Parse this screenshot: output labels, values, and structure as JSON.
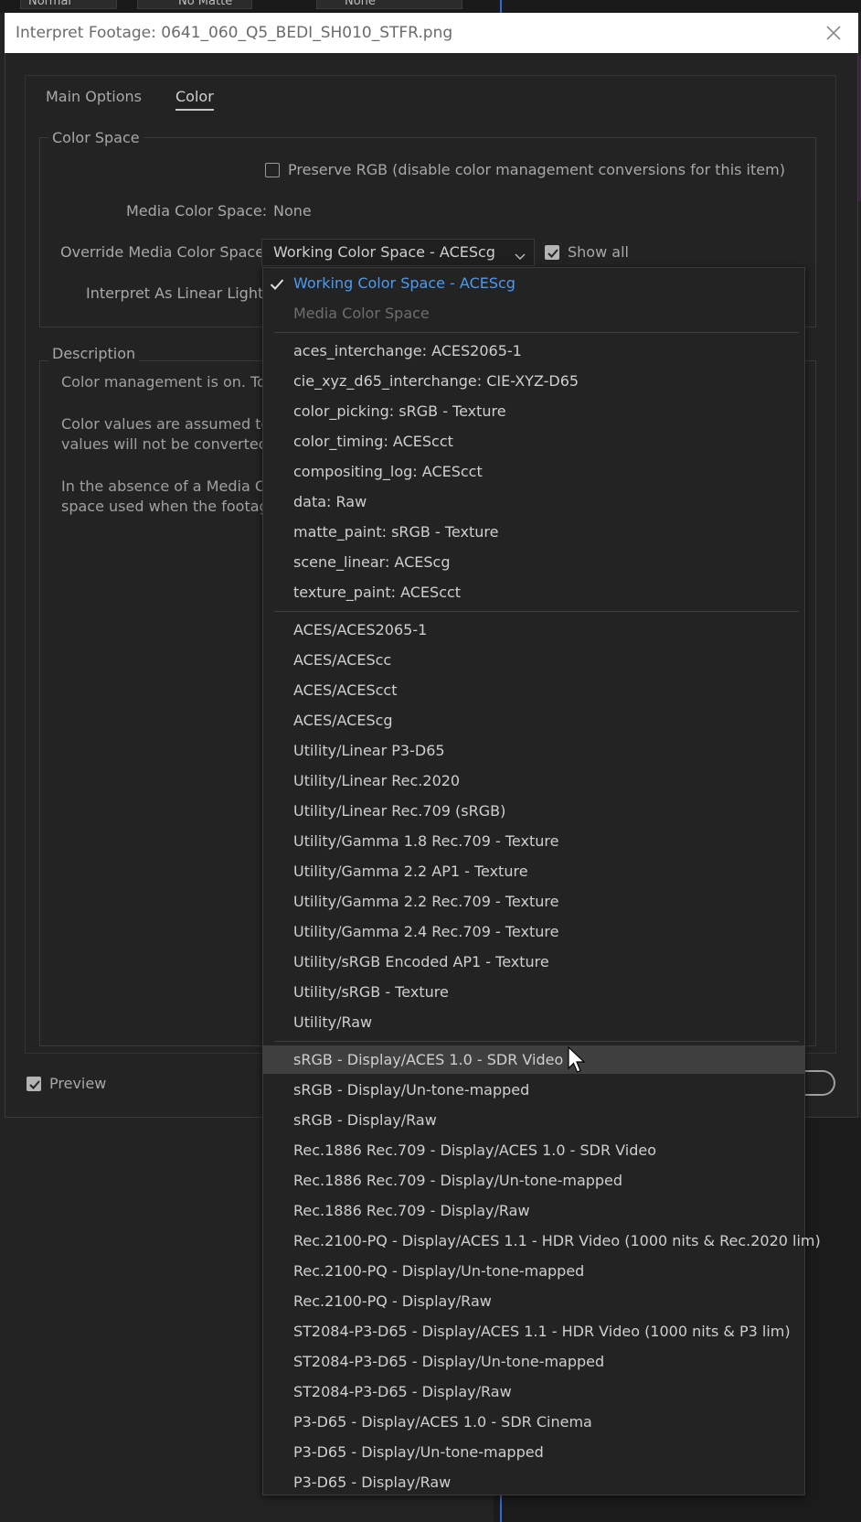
{
  "background": {
    "blend_mode": "Normal",
    "matte": "No Matte",
    "parent": "None"
  },
  "dialog": {
    "title": "Interpret Footage: 0641_060_Q5_BEDI_SH010_STFR.png"
  },
  "tabs": [
    {
      "label": "Main Options"
    },
    {
      "label": "Color"
    }
  ],
  "color_space": {
    "legend": "Color Space",
    "preserve_rgb_label": "Preserve RGB (disable color management conversions for this item)",
    "preserve_rgb_checked": false,
    "media_color_space_label": "Media Color Space:",
    "media_color_space_value": "None",
    "override_label": "Override Media Color Space:",
    "override_value": "Working Color Space - ACEScg",
    "show_all_label": "Show all",
    "show_all_checked": true,
    "linear_light_label": "Interpret As Linear Light:"
  },
  "description": {
    "legend": "Description",
    "line1": "Color management is on. To tu",
    "line2": "Color values are assumed to b",
    "line3": "values will not be converted.",
    "line4": "In the absence of a Media Colo",
    "line5": "space used when the footage v"
  },
  "footer": {
    "preview_label": "Preview",
    "preview_checked": true
  },
  "dropdown": {
    "selected": "Working Color Space - ACEScg",
    "hovered": "sRGB - Display/ACES 1.0 - SDR Video",
    "items": [
      "Working Color Space - ACEScg",
      "Media Color Space",
      "aces_interchange: ACES2065-1",
      "cie_xyz_d65_interchange: CIE-XYZ-D65",
      "color_picking: sRGB - Texture",
      "color_timing: ACEScct",
      "compositing_log: ACEScct",
      "data: Raw",
      "matte_paint: sRGB - Texture",
      "scene_linear: ACEScg",
      "texture_paint: ACEScct",
      "ACES/ACES2065-1",
      "ACES/ACEScc",
      "ACES/ACEScct",
      "ACES/ACEScg",
      "Utility/Linear P3-D65",
      "Utility/Linear Rec.2020",
      "Utility/Linear Rec.709 (sRGB)",
      "Utility/Gamma 1.8 Rec.709 - Texture",
      "Utility/Gamma 2.2 AP1 - Texture",
      "Utility/Gamma 2.2 Rec.709 - Texture",
      "Utility/Gamma 2.4 Rec.709 - Texture",
      "Utility/sRGB Encoded AP1 - Texture",
      "Utility/sRGB - Texture",
      "Utility/Raw",
      "sRGB - Display/ACES 1.0 - SDR Video",
      "sRGB - Display/Un-tone-mapped",
      "sRGB - Display/Raw",
      "Rec.1886 Rec.709 - Display/ACES 1.0 - SDR Video",
      "Rec.1886 Rec.709 - Display/Un-tone-mapped",
      "Rec.1886 Rec.709 - Display/Raw",
      "Rec.2100-PQ - Display/ACES 1.1 - HDR Video (1000 nits & Rec.2020 lim)",
      "Rec.2100-PQ - Display/Un-tone-mapped",
      "Rec.2100-PQ - Display/Raw",
      "ST2084-P3-D65 - Display/ACES 1.1 - HDR Video (1000 nits & P3 lim)",
      "ST2084-P3-D65 - Display/Un-tone-mapped",
      "ST2084-P3-D65 - Display/Raw",
      "P3-D65 - Display/ACES 1.0 - SDR Cinema",
      "P3-D65 - Display/Un-tone-mapped",
      "P3-D65 - Display/Raw"
    ]
  },
  "colors": {
    "accent": "#4a9bf0",
    "hover": "#404040",
    "panel": "#232323",
    "titlebar": "#ffffff"
  }
}
